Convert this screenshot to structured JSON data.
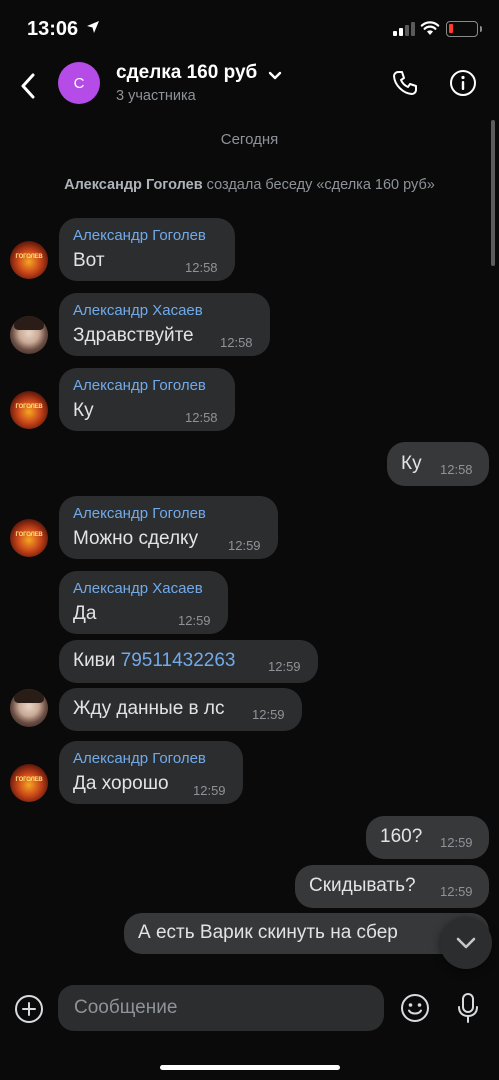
{
  "status_bar": {
    "time": "13:06"
  },
  "header": {
    "avatar_letter": "С",
    "title": "сделка 160 руб",
    "subtitle": "3 участника"
  },
  "date_label": "Сегодня",
  "system_message": {
    "author": "Александр Гоголев",
    "text": " создала беседу «сделка 160 руб»"
  },
  "messages": [
    {
      "sender": "Александр Гоголев",
      "text": "Вот",
      "time": "12:58"
    },
    {
      "sender": "Александр Хасаев",
      "text": "Здравствуйте",
      "time": "12:58"
    },
    {
      "sender": "Александр Гоголев",
      "text": "Ку",
      "time": "12:58"
    },
    {
      "text": "Ку",
      "time": "12:58",
      "outgoing": true
    },
    {
      "sender": "Александр Гоголев",
      "text": "Можно сделку",
      "time": "12:59"
    },
    {
      "sender": "Александр Хасаев",
      "text": "Да",
      "time": "12:59"
    },
    {
      "text": "Киви ",
      "phone": "79511432263",
      "time": "12:59"
    },
    {
      "text": "Жду данные в лс",
      "time": "12:59"
    },
    {
      "sender": "Александр Гоголев",
      "text": "Да хорошо",
      "time": "12:59"
    },
    {
      "text": "160?",
      "time": "12:59",
      "outgoing": true
    },
    {
      "text": "Скидывать?",
      "time": "12:59",
      "outgoing": true
    },
    {
      "text": "А есть Варик скинуть на сбер",
      "outgoing": true
    }
  ],
  "avatar_badge_text": "ГОГОЛЕВ",
  "composer": {
    "placeholder": "Сообщение"
  },
  "colors": {
    "accent": "#71aaeb",
    "bubble": "#2c2d2e",
    "background": "#0a0a0a",
    "chat_avatar": "#b54ce8"
  }
}
